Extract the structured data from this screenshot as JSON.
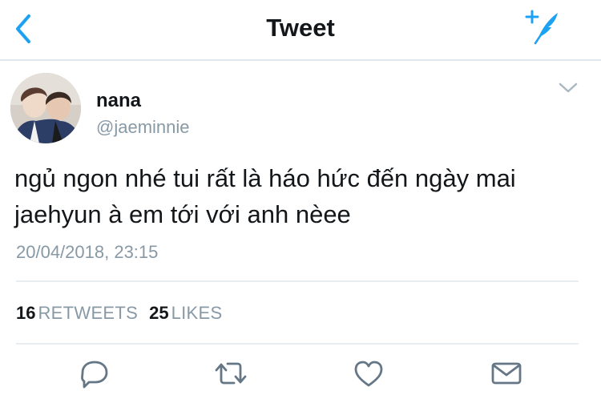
{
  "header": {
    "title": "Tweet",
    "back_icon": "chevron-left-icon",
    "compose_icon": "feather-plus-icon",
    "accent_color": "#1da1f2"
  },
  "tweet": {
    "display_name": "nana",
    "handle": "@jaeminnie",
    "text_lines": [
      "ngủ ngon nhé tui rất là háo hức đến ngày mai",
      "jaehyun à em tới với anh nèee"
    ],
    "timestamp": "20/04/2018, 23:15",
    "retweets": {
      "count": "16",
      "label": "RETWEETS"
    },
    "likes": {
      "count": "25",
      "label": "LIKES"
    }
  },
  "actions": [
    {
      "icon": "reply-icon"
    },
    {
      "icon": "retweet-icon"
    },
    {
      "icon": "heart-icon"
    },
    {
      "icon": "mail-icon"
    }
  ],
  "colors": {
    "text": "#14171a",
    "secondary": "#8899a6",
    "divider": "#e6ecf0"
  }
}
